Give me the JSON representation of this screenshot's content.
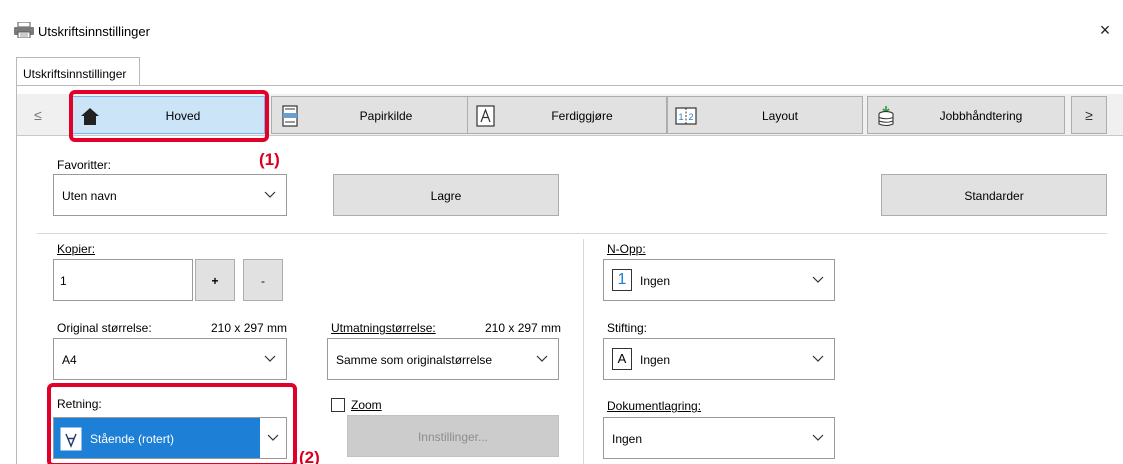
{
  "window": {
    "title": "Utskriftsinnstillinger",
    "close_glyph": "×"
  },
  "tabs": [
    {
      "label": "Utskriftsinnstillinger"
    }
  ],
  "nav": {
    "prev_glyph": "≤",
    "next_glyph": "≥",
    "items": [
      {
        "label": "Hoved",
        "icon": "home-icon",
        "active": true
      },
      {
        "label": "Papirkilde",
        "icon": "paper-tray-icon"
      },
      {
        "label": "Ferdiggjøre",
        "icon": "finishing-icon"
      },
      {
        "label": "Layout",
        "icon": "layout-icon"
      },
      {
        "label": "Jobbhåndtering",
        "icon": "job-handling-icon"
      }
    ]
  },
  "callouts": {
    "c1": "(1)",
    "c2": "(2)"
  },
  "favorites": {
    "label": "Favoritter:",
    "value": "Uten navn",
    "save_label": "Lagre",
    "defaults_label": "Standarder"
  },
  "copies": {
    "label": "Kopier:",
    "value": "1",
    "plus": "+",
    "minus": "-"
  },
  "original_size": {
    "label": "Original størrelse:",
    "dims": "210 x 297 mm",
    "value": "A4"
  },
  "output_size": {
    "label": "Utmatningstørrelse:",
    "dims": "210 x 297 mm",
    "value": "Samme som originalstørrelse"
  },
  "orientation": {
    "label": "Retning:",
    "value": "Stående (rotert)"
  },
  "zoom": {
    "label": "Zoom",
    "checked": false,
    "settings_label": "Innstillinger..."
  },
  "n_up": {
    "label": "N-Opp:",
    "icon_text": "1",
    "value": "Ingen"
  },
  "stapling": {
    "label": "Stifting:",
    "icon_text": "A",
    "value": "Ingen"
  },
  "document_storage": {
    "label": "Dokumentlagring:",
    "value": "Ingen"
  },
  "colors": {
    "highlight": "#e0002a",
    "selection": "#1e7fd6",
    "active_tab": "#cce4f7"
  }
}
